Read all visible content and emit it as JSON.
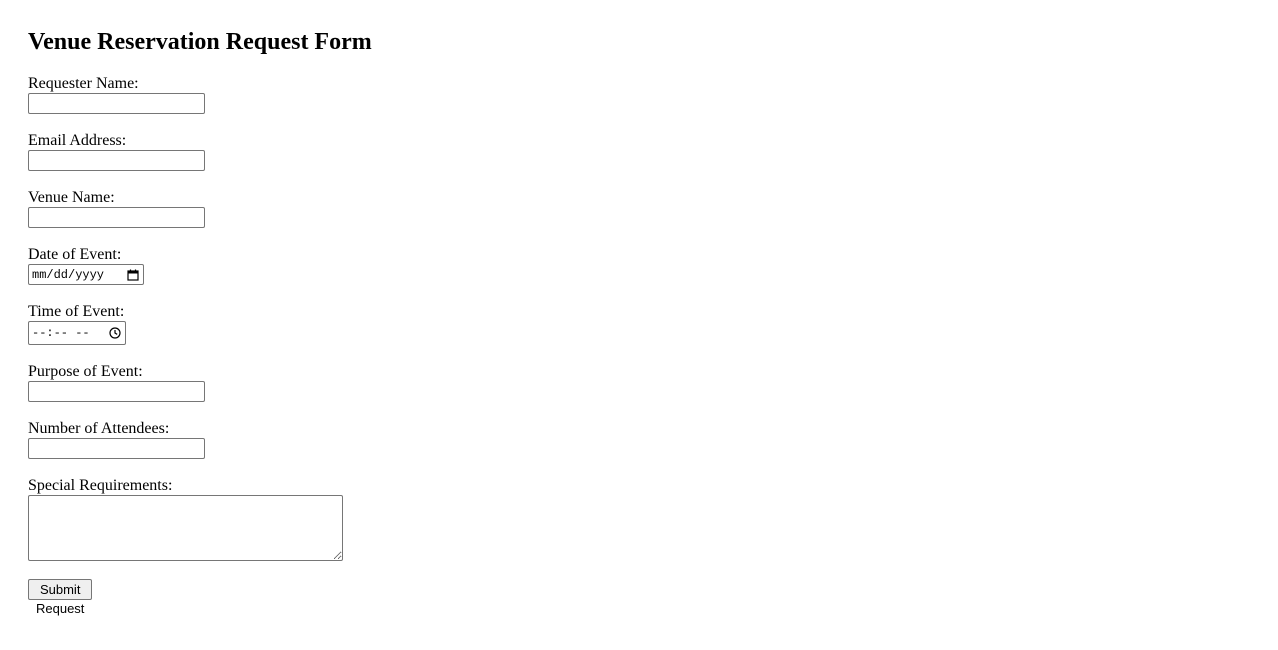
{
  "form": {
    "title": "Venue Reservation Request Form",
    "fields": {
      "requester_name": {
        "label": "Requester Name:",
        "value": ""
      },
      "email": {
        "label": "Email Address:",
        "value": ""
      },
      "venue_name": {
        "label": "Venue Name:",
        "value": ""
      },
      "event_date": {
        "label": "Date of Event:",
        "placeholder": "mm/dd/yyyy"
      },
      "event_time": {
        "label": "Time of Event:",
        "placeholder": "--:-- --"
      },
      "purpose": {
        "label": "Purpose of Event:",
        "value": ""
      },
      "attendees": {
        "label": "Number of Attendees:",
        "value": ""
      },
      "special_requirements": {
        "label": "Special Requirements:",
        "value": ""
      }
    },
    "submit_label": "Submit Request"
  },
  "icons": {
    "date_picker": "calendar-icon",
    "time_picker": "clock-icon"
  }
}
